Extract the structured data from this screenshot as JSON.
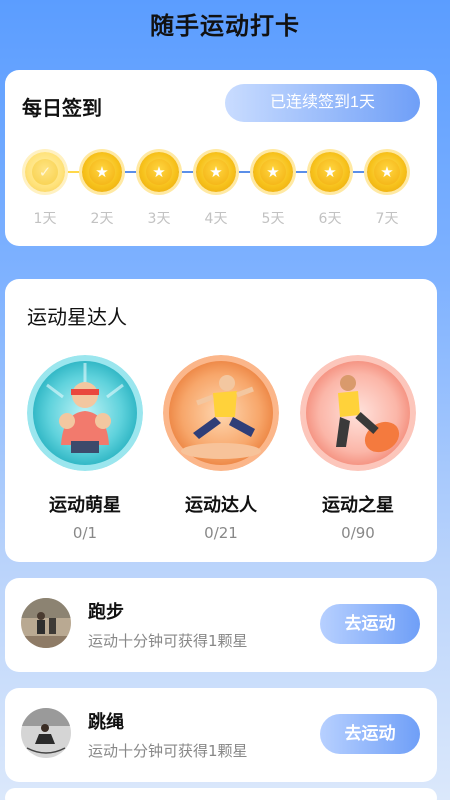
{
  "page": {
    "title": "随手运动打卡"
  },
  "checkin": {
    "title": "每日签到",
    "streak_label": "已连续签到1天",
    "days": [
      {
        "label": "1天",
        "done": true
      },
      {
        "label": "2天",
        "done": false
      },
      {
        "label": "3天",
        "done": false
      },
      {
        "label": "4天",
        "done": false
      },
      {
        "label": "5天",
        "done": false
      },
      {
        "label": "6天",
        "done": false
      },
      {
        "label": "7天",
        "done": false
      }
    ],
    "colors": {
      "line_done": "#ffd84a",
      "line_todo": "#5b8fe8"
    }
  },
  "stars": {
    "title": "运动星达人",
    "badges": [
      {
        "name": "运动萌星",
        "count": "0/1",
        "icon": "cute-star-badge-icon"
      },
      {
        "name": "运动达人",
        "count": "0/21",
        "icon": "expert-badge-icon"
      },
      {
        "name": "运动之星",
        "count": "0/90",
        "icon": "star-badge-icon"
      }
    ]
  },
  "exercises": [
    {
      "name": "跑步",
      "desc": "运动十分钟可获得1颗星",
      "button": "去运动",
      "icon": "running-thumbnail"
    },
    {
      "name": "跳绳",
      "desc": "运动十分钟可获得1颗星",
      "button": "去运动",
      "icon": "rope-skipping-thumbnail"
    }
  ]
}
